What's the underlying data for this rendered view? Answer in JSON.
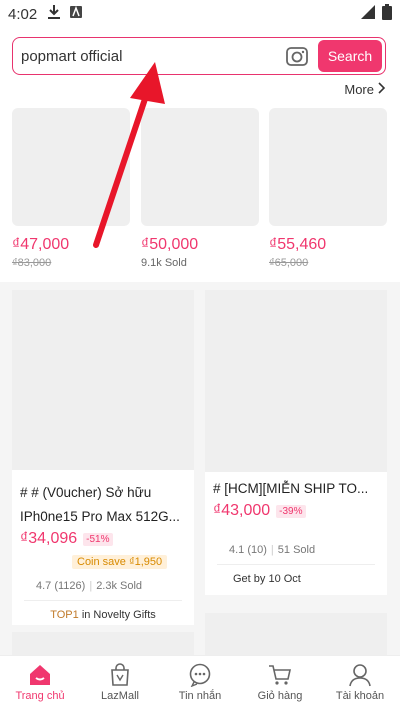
{
  "status_bar": {
    "time": "4:02"
  },
  "search": {
    "value": "popmart official",
    "button_label": "Search"
  },
  "more_label": "More",
  "top_products": [
    {
      "price": "₫47,000",
      "sub": "₫83,000",
      "sub_strike": true
    },
    {
      "price": "₫50,000",
      "sub": "9.1k Sold",
      "sub_strike": false
    },
    {
      "price": "₫55,460",
      "sub": "₫65,000",
      "sub_strike": true
    }
  ],
  "products": [
    {
      "title_line1": "# # (V0ucher) Sở hữu",
      "title_line2": "IPh0ne15 Pro Max 512G...",
      "price": "₫34,096",
      "discount": "-51%",
      "coin_save": "Coin save ₫1,950",
      "rating": "4.7 (1126)",
      "sold": "2.3k Sold",
      "tag_prefix": "TOP1",
      "tag_text": "in Novelty Gifts"
    },
    {
      "title_line1": "# [HCM][MIỄN SHIP TO...",
      "price": "₫43,000",
      "discount": "-39%",
      "rating": "4.1 (10)",
      "sold": "51 Sold",
      "delivery": "Get by  10 Oct"
    }
  ],
  "bottom_nav": [
    {
      "label": "Trang chủ",
      "icon": "home-icon",
      "active": true
    },
    {
      "label": "LazMall",
      "icon": "lazmall-bag-icon",
      "active": false
    },
    {
      "label": "Tin nhắn",
      "icon": "message-icon",
      "active": false
    },
    {
      "label": "Giỏ hàng",
      "icon": "cart-icon",
      "active": false
    },
    {
      "label": "Tài khoản",
      "icon": "account-icon",
      "active": false
    }
  ],
  "colors": {
    "accent": "#f0376e",
    "arrow": "#e8162a"
  }
}
